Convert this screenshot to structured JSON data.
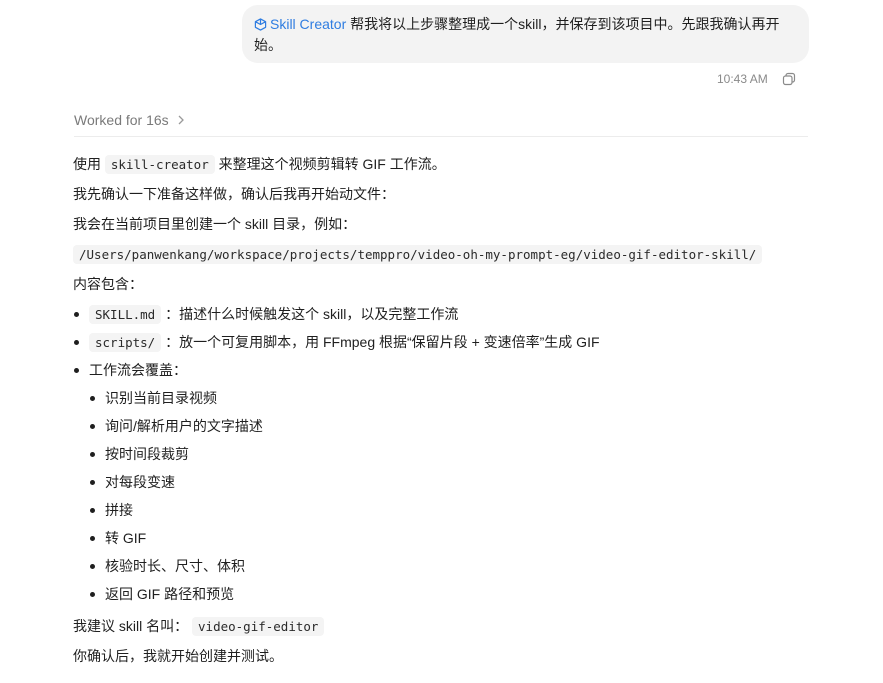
{
  "user_message": {
    "skill_chip": "Skill Creator",
    "text_line1": "帮我将以上步骤整理成一个skill，并保存到该项目中。先跟我确认再开",
    "text_line2": "始。",
    "time": "10:43 AM"
  },
  "worked": {
    "label": "Worked for 16s"
  },
  "response": {
    "p1_prefix": "使用",
    "p1_code": "skill-creator",
    "p1_suffix": "来整理这个视频剪辑转 GIF 工作流。",
    "p2": "我先确认一下准备这样做，确认后我再开始动文件：",
    "p3": "我会在当前项目里创建一个 skill 目录，例如：",
    "path_code": "/Users/panwenkang/workspace/projects/temppro/video-oh-my-prompt-eg/video-gif-editor-skill/",
    "p4": "内容包含：",
    "bullets": [
      {
        "code": "SKILL.md",
        "text": "：描述什么时候触发这个 skill，以及完整工作流"
      },
      {
        "code": "scripts/",
        "text": "：放一个可复用脚本，用 FFmpeg 根据“保留片段 + 变速倍率”生成 GIF"
      }
    ],
    "workflow_label": "工作流会覆盖：",
    "workflow_items": [
      "识别当前目录视频",
      "询问/解析用户的文字描述",
      "按时间段裁剪",
      "对每段变速",
      "拼接",
      "转 GIF",
      "核验时长、尺寸、体积",
      "返回 GIF 路径和预览"
    ],
    "name_prefix": "我建议 skill 名叫：",
    "name_code": "video-gif-editor",
    "closing": "你确认后，我就开始创建并测试。"
  }
}
